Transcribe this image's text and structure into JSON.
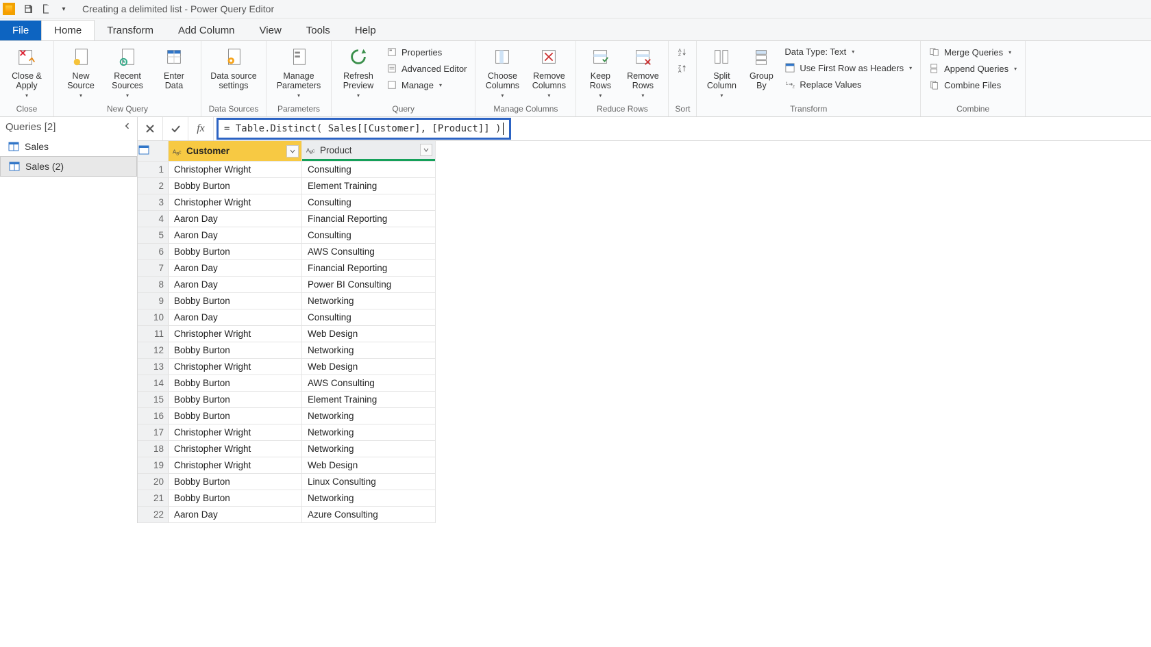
{
  "title": "Creating a delimited list - Power Query Editor",
  "tabs": {
    "file": "File",
    "home": "Home",
    "transform": "Transform",
    "add_column": "Add Column",
    "view": "View",
    "tools": "Tools",
    "help": "Help"
  },
  "ribbon": {
    "close": {
      "close_apply": "Close &\nApply",
      "group": "Close"
    },
    "new_query": {
      "new_source": "New\nSource",
      "recent_sources": "Recent\nSources",
      "enter_data": "Enter\nData",
      "group": "New Query"
    },
    "data_sources": {
      "data_source_settings": "Data source\nsettings",
      "group": "Data Sources"
    },
    "parameters": {
      "manage_parameters": "Manage\nParameters",
      "group": "Parameters"
    },
    "query": {
      "refresh_preview": "Refresh\nPreview",
      "properties": "Properties",
      "advanced_editor": "Advanced Editor",
      "manage": "Manage",
      "group": "Query"
    },
    "manage_columns": {
      "choose_columns": "Choose\nColumns",
      "remove_columns": "Remove\nColumns",
      "group": "Manage Columns"
    },
    "reduce_rows": {
      "keep_rows": "Keep\nRows",
      "remove_rows": "Remove\nRows",
      "group": "Reduce Rows"
    },
    "sort": {
      "group": "Sort"
    },
    "transform": {
      "split_column": "Split\nColumn",
      "group_by": "Group\nBy",
      "data_type": "Data Type: Text",
      "first_row_headers": "Use First Row as Headers",
      "replace_values": "Replace Values",
      "group": "Transform"
    },
    "combine": {
      "merge_queries": "Merge Queries",
      "append_queries": "Append Queries",
      "combine_files": "Combine Files",
      "group": "Combine"
    }
  },
  "queries": {
    "header": "Queries [2]",
    "items": [
      {
        "label": "Sales"
      },
      {
        "label": "Sales (2)"
      }
    ]
  },
  "formula": "= Table.Distinct( Sales[[Customer], [Product]] )",
  "columns": [
    "Customer",
    "Product"
  ],
  "rows": [
    [
      "Christopher Wright",
      "Consulting"
    ],
    [
      "Bobby Burton",
      "Element Training"
    ],
    [
      "Christopher Wright",
      "Consulting"
    ],
    [
      "Aaron Day",
      "Financial Reporting"
    ],
    [
      "Aaron Day",
      "Consulting"
    ],
    [
      "Bobby Burton",
      "AWS Consulting"
    ],
    [
      "Aaron Day",
      "Financial Reporting"
    ],
    [
      "Aaron Day",
      "Power BI Consulting"
    ],
    [
      "Bobby Burton",
      "Networking"
    ],
    [
      "Aaron Day",
      "Consulting"
    ],
    [
      "Christopher Wright",
      "Web Design"
    ],
    [
      "Bobby Burton",
      "Networking"
    ],
    [
      "Christopher Wright",
      "Web Design"
    ],
    [
      "Bobby Burton",
      "AWS Consulting"
    ],
    [
      "Bobby Burton",
      "Element Training"
    ],
    [
      "Bobby Burton",
      "Networking"
    ],
    [
      "Christopher Wright",
      "Networking"
    ],
    [
      "Christopher Wright",
      "Networking"
    ],
    [
      "Christopher Wright",
      "Web Design"
    ],
    [
      "Bobby Burton",
      "Linux Consulting"
    ],
    [
      "Bobby Burton",
      "Networking"
    ],
    [
      "Aaron Day",
      "Azure Consulting"
    ]
  ]
}
